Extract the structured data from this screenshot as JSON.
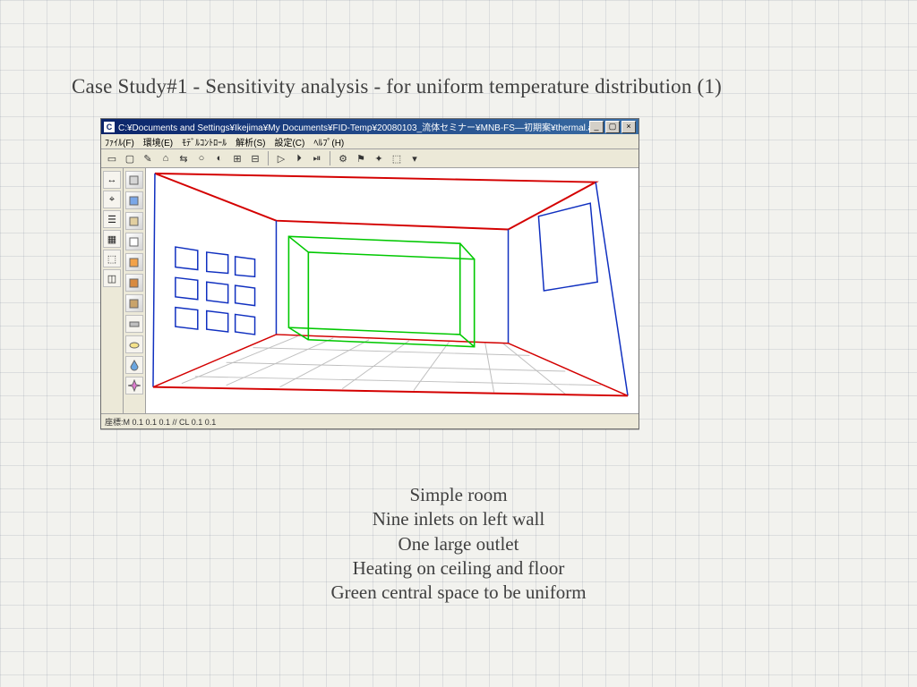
{
  "slide": {
    "title": "Case Study#1 - Sensitivity analysis - for uniform temperature distribution (1)"
  },
  "app": {
    "title_prefix": "C:¥Documents and Settings¥Ikejima¥My Documents¥FID-Temp¥20080103_流体セミナー¥MNB-FS—初期案¥thermal.adv_thermal  —",
    "menus": [
      "ﾌｧｲﾙ(F)",
      "環境(E)",
      "ﾓﾃﾞﾙｺﾝﾄﾛｰﾙ",
      "解析(S)",
      "設定(C)",
      "ﾍﾙﾌﾟ(H)"
    ],
    "status": "座標:M 0.1 0.1 0.1 // CL 0.1 0.1"
  },
  "toolbar_icons": [
    "▭",
    "▢",
    "✎",
    "⌂",
    "⇆",
    "○",
    "◐",
    "⊞",
    "⊟",
    "│",
    "▷",
    "⏵",
    "⏯",
    "│",
    "⚙",
    "⚑",
    "✦",
    "⬚",
    "▾"
  ],
  "side_icons": [
    "↔",
    "⌖",
    "☰",
    "▦",
    "⬚",
    "◫"
  ],
  "object_icons": [
    {
      "name": "cube-gray-icon",
      "fill": "#d5d5d5"
    },
    {
      "name": "cube-blue-icon",
      "fill": "#7aa7e8"
    },
    {
      "name": "cube-tan-icon",
      "fill": "#e2cfa0"
    },
    {
      "name": "cube-white-icon",
      "fill": "#ffffff"
    },
    {
      "name": "cube-orange-icon",
      "fill": "#f2a24a"
    },
    {
      "name": "cube-brick-icon",
      "fill": "#d88a3f"
    },
    {
      "name": "cube-wood-icon",
      "fill": "#c9a36a"
    },
    {
      "name": "panel-gray-icon",
      "fill": "#bfbfbf"
    },
    {
      "name": "disc-yellow-icon",
      "fill": "#f4e28a"
    },
    {
      "name": "drop-blue-icon",
      "fill": "#6aa6e0"
    },
    {
      "name": "spark-icon",
      "fill": "#e07ad0"
    }
  ],
  "caption_lines": [
    "Simple room",
    "Nine inlets on left wall",
    "One large outlet",
    "Heating on ceiling and floor",
    "Green central space to be uniform"
  ],
  "scene": {
    "ceiling_color": "#d40000",
    "floor_color": "#d40000",
    "inlet_outline": "#1030c0",
    "outlet_outline": "#1030c0",
    "uniform_zone_color": "#00c800",
    "wall_edge_color": "#1030c0",
    "floor_grid_color": "#bfbfbf"
  }
}
